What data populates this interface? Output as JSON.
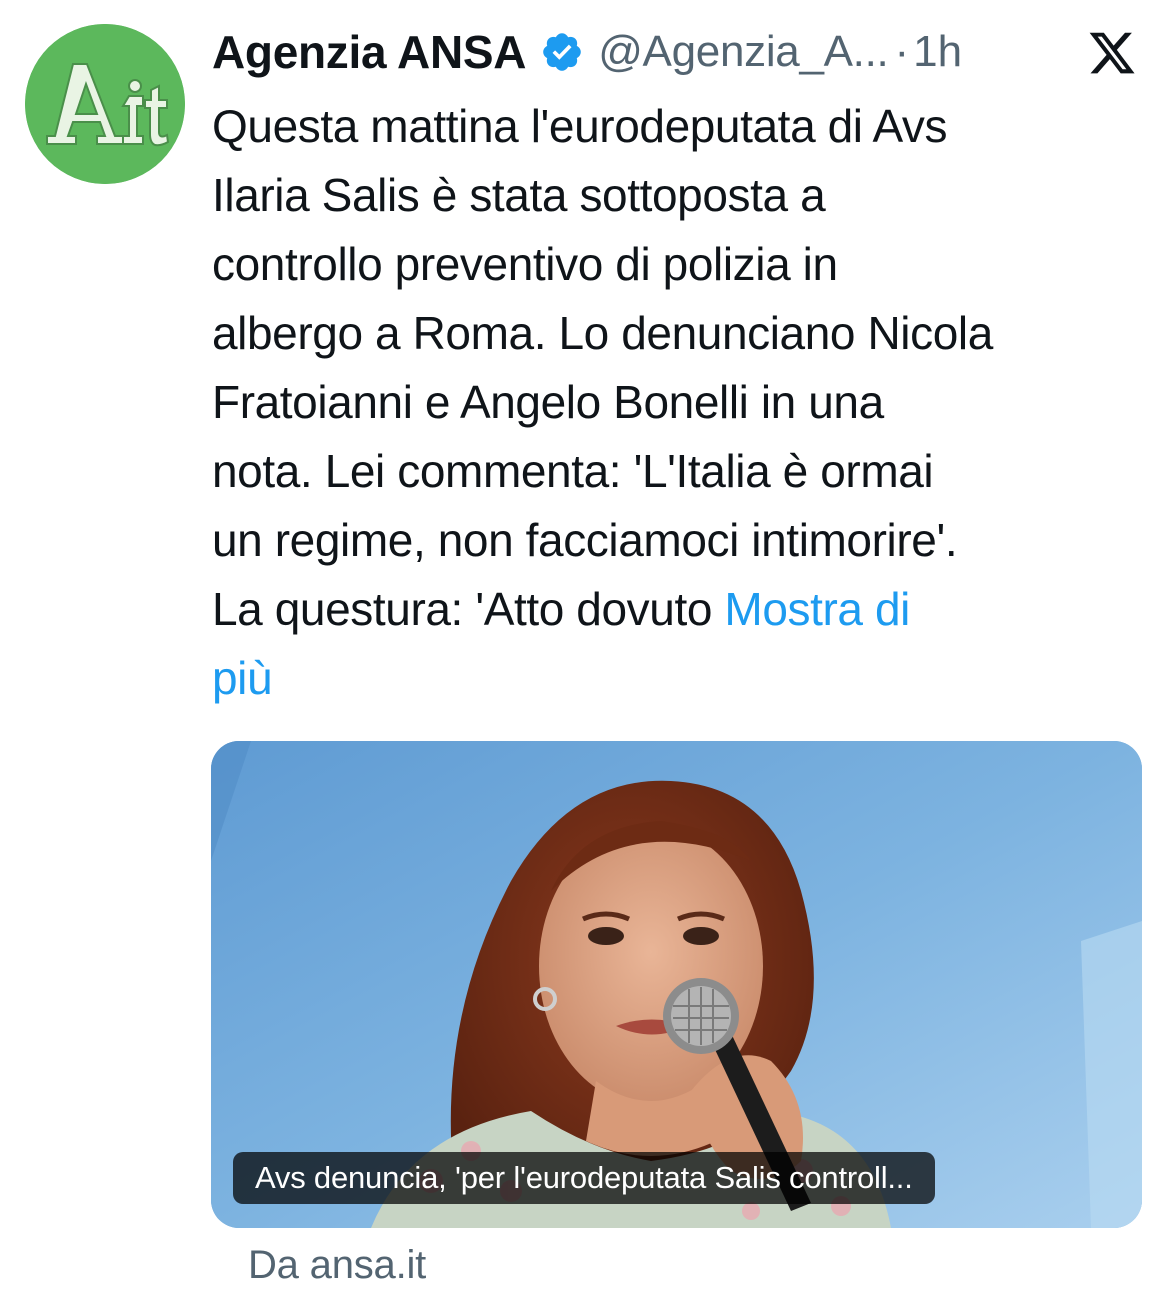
{
  "author": {
    "name": "Agenzia ANSA",
    "handle": "@Agenzia_A...",
    "separator": "·",
    "time": "1h",
    "avatar_text": "Ait",
    "verified_icon": "verified-badge-icon",
    "avatar_color": "#5cb85c"
  },
  "tweet": {
    "lines": [
      "Questa mattina l'eurodeputata di Avs",
      "Ilaria Salis è stata sottoposta a",
      "controllo preventivo di polizia in",
      "albergo a Roma. Lo denunciano Nicola",
      "Fratoianni e Angelo Bonelli in una",
      "nota. Lei commenta: 'L'Italia è ormai",
      "un regime, non facciamoci intimorire'.",
      "La questura: 'Atto dovuto "
    ],
    "show_more_part1": "Mostra di",
    "show_more_part2": "più"
  },
  "card": {
    "caption": "Avs denuncia, 'per l'eurodeputata Salis controll...",
    "source": "Da ansa.it"
  },
  "colors": {
    "link": "#1d9bf0",
    "secondary_text": "#536471",
    "verified": "#1d9bf0"
  }
}
